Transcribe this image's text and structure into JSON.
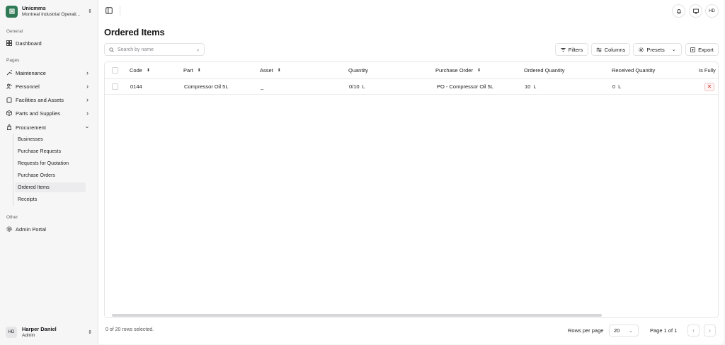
{
  "org": {
    "name": "Unicmms",
    "subtitle": "Montreal Industrial Operati..."
  },
  "sidebar": {
    "general_label": "General",
    "dashboard": "Dashboard",
    "pages_label": "Pages",
    "items": [
      {
        "label": "Maintenance",
        "icon": "wrench-icon"
      },
      {
        "label": "Personnel",
        "icon": "people-icon"
      },
      {
        "label": "Facilities and Assets",
        "icon": "building-icon"
      },
      {
        "label": "Parts and Supplies",
        "icon": "box-icon"
      },
      {
        "label": "Procurement",
        "icon": "cart-icon"
      }
    ],
    "procurement_sub": [
      "Businesses",
      "Purchase Requests",
      "Requests for Quotation",
      "Purchase Orders",
      "Ordered Items",
      "Receipts"
    ],
    "other_label": "Other",
    "admin": "Admin Portal"
  },
  "user": {
    "initials": "HD",
    "name": "Harper Daniel",
    "role": "Admin"
  },
  "topbar": {
    "avatar_initials": "HD"
  },
  "page": {
    "title": "Ordered Items"
  },
  "search": {
    "placeholder": "Search by name"
  },
  "toolbar": {
    "filters": "Filters",
    "columns": "Columns",
    "presets": "Presets",
    "export": "Export"
  },
  "table": {
    "headers": [
      "Code",
      "Part",
      "Asset",
      "Quantity",
      "Purchase Order",
      "Ordered Quantity",
      "Received Quantity",
      "Is Fully"
    ],
    "rows": [
      {
        "code": "0144",
        "part": "Compressor Oil 5L",
        "asset": "_",
        "quantity": "0/10",
        "quantity_unit": "L",
        "purchase_order": "PO - Compressor Oil 5L",
        "ordered_qty": "10",
        "ordered_unit": "L",
        "received_qty": "0",
        "received_unit": "L",
        "is_fully": "✕"
      }
    ]
  },
  "footer": {
    "selected": "0 of 20 rows selected.",
    "rows_per_page_label": "Rows per page",
    "rows_per_page": "20",
    "page": "Page 1 of 1"
  }
}
